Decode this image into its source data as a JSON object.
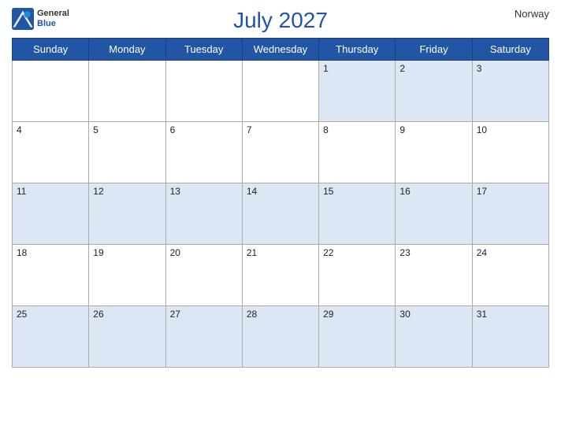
{
  "header": {
    "title": "July 2027",
    "country": "Norway",
    "logo": {
      "general": "General",
      "blue": "Blue"
    }
  },
  "days_of_week": [
    "Sunday",
    "Monday",
    "Tuesday",
    "Wednesday",
    "Thursday",
    "Friday",
    "Saturday"
  ],
  "weeks": [
    [
      null,
      null,
      null,
      null,
      1,
      2,
      3
    ],
    [
      4,
      5,
      6,
      7,
      8,
      9,
      10
    ],
    [
      11,
      12,
      13,
      14,
      15,
      16,
      17
    ],
    [
      18,
      19,
      20,
      21,
      22,
      23,
      24
    ],
    [
      25,
      26,
      27,
      28,
      29,
      30,
      31
    ]
  ]
}
